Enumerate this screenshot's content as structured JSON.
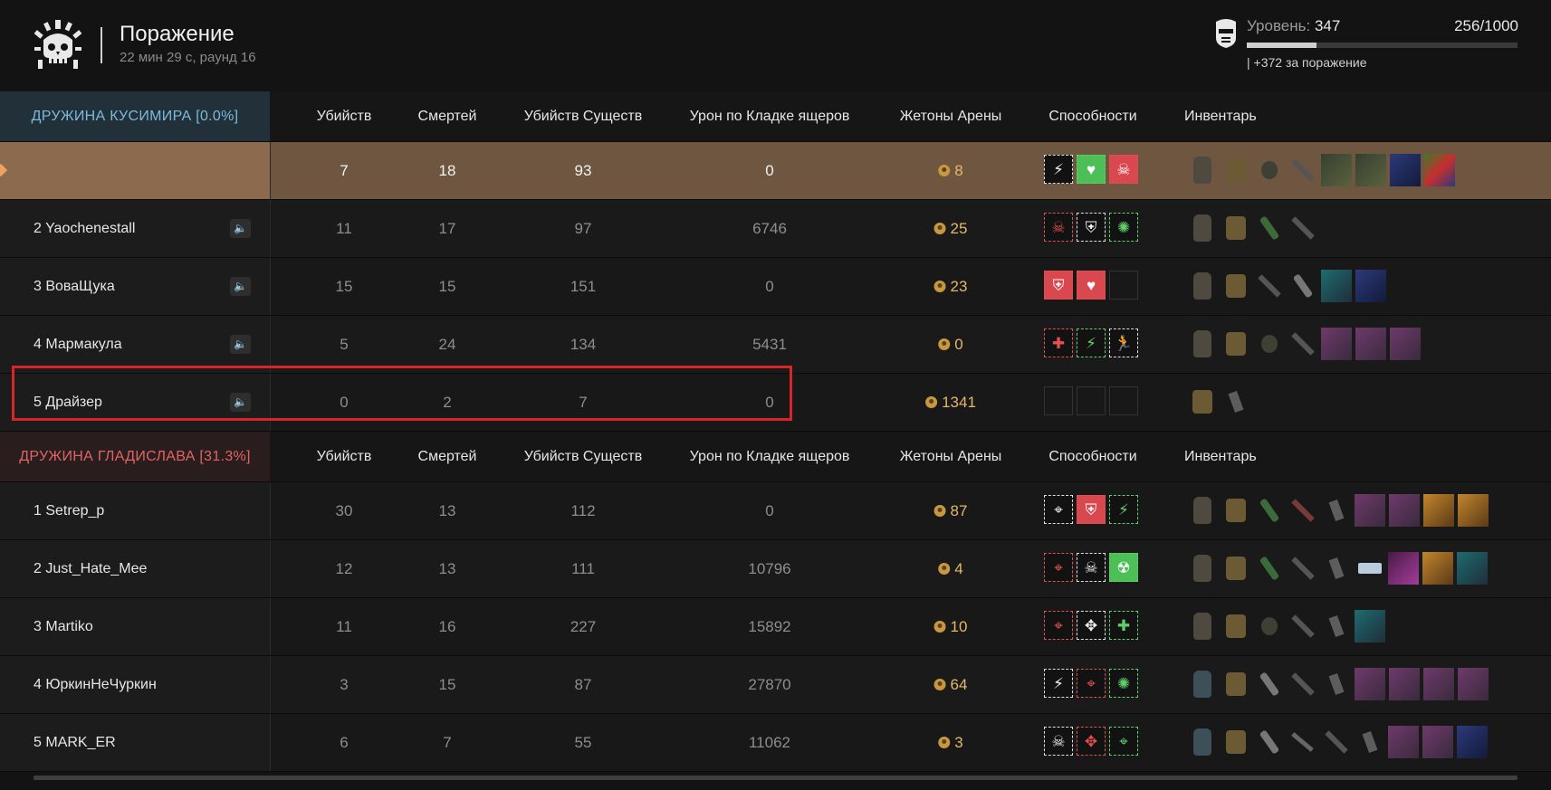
{
  "header": {
    "title": "Поражение",
    "subtitle": "22 мин 29 с, раунд 16",
    "level_label": "Уровень:",
    "level_value": "347",
    "xp": "256/1000",
    "xp_progress": 0.256,
    "bonus": "| +372 за поражение"
  },
  "columns": {
    "kills": "Убийств",
    "deaths": "Смертей",
    "creature_kills": "Убийств Существ",
    "damage": "Урон по Кладке ящеров",
    "tokens": "Жетоны Арены",
    "abilities": "Способности",
    "inventory": "Инвентарь"
  },
  "teams": [
    {
      "name": "ДРУЖИНА КУСИМИРА [0.0%]",
      "color": "#7bbad8",
      "players": [
        {
          "rank": "",
          "name": "",
          "kills": "7",
          "deaths": "18",
          "creature_kills": "93",
          "damage": "0",
          "tokens": "8",
          "me": true
        },
        {
          "rank": "2",
          "name": "Yaochenestall",
          "kills": "11",
          "deaths": "17",
          "creature_kills": "97",
          "damage": "6746",
          "tokens": "25"
        },
        {
          "rank": "3",
          "name": "ВоваЩука",
          "kills": "15",
          "deaths": "15",
          "creature_kills": "151",
          "damage": "0",
          "tokens": "23"
        },
        {
          "rank": "4",
          "name": "Мармакула",
          "kills": "5",
          "deaths": "24",
          "creature_kills": "134",
          "damage": "5431",
          "tokens": "0"
        },
        {
          "rank": "5",
          "name": "Драйзер",
          "kills": "0",
          "deaths": "2",
          "creature_kills": "7",
          "damage": "0",
          "tokens": "1341"
        }
      ]
    },
    {
      "name": "ДРУЖИНА ГЛАДИСЛАВА [31.3%]",
      "color": "#e06464",
      "players": [
        {
          "rank": "1",
          "name": "Setrep_p",
          "kills": "30",
          "deaths": "13",
          "creature_kills": "112",
          "damage": "0",
          "tokens": "87"
        },
        {
          "rank": "2",
          "name": "Just_Hate_Mee",
          "kills": "12",
          "deaths": "13",
          "creature_kills": "111",
          "damage": "10796",
          "tokens": "4"
        },
        {
          "rank": "3",
          "name": "Martiko",
          "kills": "11",
          "deaths": "16",
          "creature_kills": "227",
          "damage": "15892",
          "tokens": "10"
        },
        {
          "rank": "4",
          "name": "ЮркинНеЧуркин",
          "kills": "3",
          "deaths": "15",
          "creature_kills": "87",
          "damage": "27870",
          "tokens": "64"
        },
        {
          "rank": "5",
          "name": "MARK_ER",
          "kills": "6",
          "deaths": "7",
          "creature_kills": "55",
          "damage": "11062",
          "tokens": "3"
        }
      ]
    }
  ],
  "icons": {
    "speaker": "speaker-icon",
    "token": "arena-token-icon",
    "logo": "skull-emblem-icon",
    "level": "helmet-icon"
  }
}
